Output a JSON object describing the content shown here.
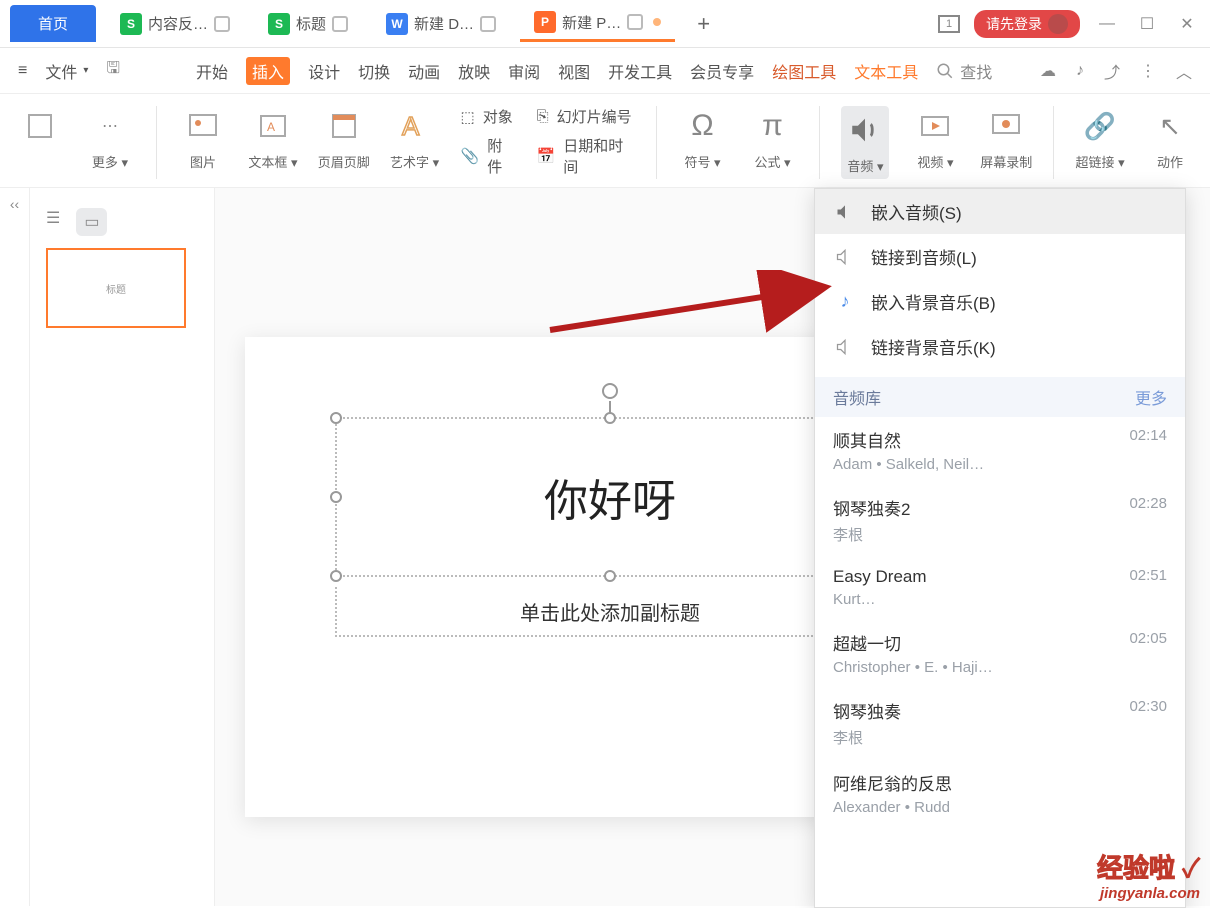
{
  "tabs": {
    "home": "首页",
    "t1": "内容反…",
    "t2": "标题",
    "t3": "新建 D…",
    "t4": "新建 P…"
  },
  "topright": {
    "login": "请先登录"
  },
  "menubar": {
    "file": "文件",
    "items": [
      "开始",
      "插入",
      "设计",
      "切换",
      "动画",
      "放映",
      "审阅",
      "视图",
      "开发工具",
      "会员专享",
      "绘图工具",
      "文本工具"
    ],
    "search": "查找"
  },
  "ribbon": {
    "more": "更多 ▾",
    "pic": "图片",
    "textbox": "文本框 ▾",
    "hf": "页眉页脚",
    "wordart": "艺术字 ▾",
    "obj": "对象",
    "attach": "附件",
    "slidenum": "幻灯片编号",
    "datetime": "日期和时间",
    "symbol": "符号 ▾",
    "equation": "公式 ▾",
    "audio": "音频 ▾",
    "video": "视频 ▾",
    "screenrec": "屏幕录制",
    "hyperlink": "超链接 ▾",
    "action": "动作"
  },
  "slide": {
    "title": "你好呀",
    "subtitle": "单击此处添加副标题",
    "thumb_text": "标题"
  },
  "dropdown": {
    "items": [
      {
        "label": "嵌入音频(S)"
      },
      {
        "label": "链接到音频(L)"
      },
      {
        "label": "嵌入背景音乐(B)"
      },
      {
        "label": "链接背景音乐(K)"
      }
    ],
    "library": "音频库",
    "more": "更多",
    "tracks": [
      {
        "name": "顺其自然",
        "artist": "Adam • Salkeld,   Neil…",
        "dur": "02:14"
      },
      {
        "name": "钢琴独奏2",
        "artist": "李根",
        "dur": "02:28"
      },
      {
        "name": "Easy Dream",
        "artist": "Kurt…",
        "dur": "02:51"
      },
      {
        "name": "超越一切",
        "artist": "Christopher • E. • Haji…",
        "dur": "02:05"
      },
      {
        "name": "钢琴独奏",
        "artist": "李根",
        "dur": "02:30"
      },
      {
        "name": "阿维尼翁的反思",
        "artist": "Alexander • Rudd",
        "dur": ""
      }
    ]
  },
  "watermark": {
    "line1": "经验啦",
    "check": "✓",
    "line2": "jingyanla.com"
  }
}
